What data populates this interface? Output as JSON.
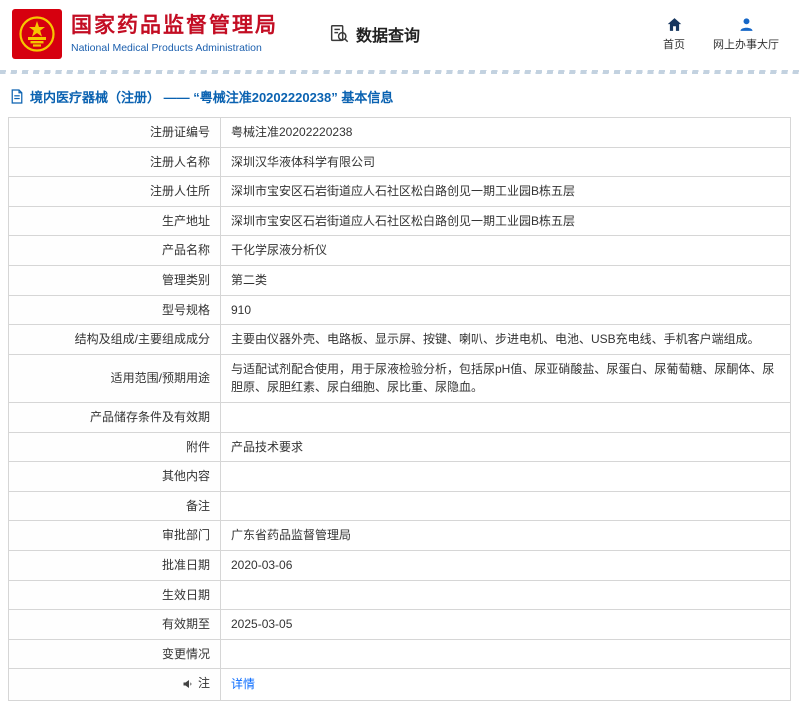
{
  "header": {
    "org_cn": "国家药品监督管理局",
    "org_en": "National Medical Products Administration",
    "tool_title": "数据查询",
    "nav_home": "首页",
    "nav_hall": "网上办事大厅"
  },
  "breadcrumb": {
    "text": "境内医疗器械（注册） —— “粤械注准20202220238” 基本信息"
  },
  "colors": {
    "brand_red": "#c30d23",
    "brand_blue": "#1b5fae",
    "breadcrumb_blue": "#0a62b1",
    "link_blue": "#0a6cff",
    "table_border": "#d6d6d6"
  },
  "table": {
    "rows": [
      {
        "label": "注册证编号",
        "value": "粤械注准20202220238"
      },
      {
        "label": "注册人名称",
        "value": "深圳汉华液体科学有限公司"
      },
      {
        "label": "注册人住所",
        "value": "深圳市宝安区石岩街道应人石社区松白路创见一期工业园B栋五层"
      },
      {
        "label": "生产地址",
        "value": "深圳市宝安区石岩街道应人石社区松白路创见一期工业园B栋五层"
      },
      {
        "label": "产品名称",
        "value": "干化学尿液分析仪"
      },
      {
        "label": "管理类别",
        "value": "第二类"
      },
      {
        "label": "型号规格",
        "value": "910"
      },
      {
        "label": "结构及组成/主要组成成分",
        "value": "主要由仪器外壳、电路板、显示屏、按键、喇叭、步进电机、电池、USB充电线、手机客户端组成。"
      },
      {
        "label": "适用范围/预期用途",
        "value": "与适配试剂配合使用，用于尿液检验分析，包括尿pH值、尿亚硝酸盐、尿蛋白、尿葡萄糖、尿酮体、尿胆原、尿胆红素、尿白细胞、尿比重、尿隐血。"
      },
      {
        "label": "产品储存条件及有效期",
        "value": ""
      },
      {
        "label": "附件",
        "value": "产品技术要求"
      },
      {
        "label": "其他内容",
        "value": ""
      },
      {
        "label": "备注",
        "value": ""
      },
      {
        "label": "审批部门",
        "value": "广东省药品监督管理局"
      },
      {
        "label": "批准日期",
        "value": "2020-03-06"
      },
      {
        "label": "生效日期",
        "value": ""
      },
      {
        "label": "有效期至",
        "value": "2025-03-05"
      },
      {
        "label": "变更情况",
        "value": ""
      },
      {
        "label": "注",
        "value": "详情"
      }
    ]
  }
}
